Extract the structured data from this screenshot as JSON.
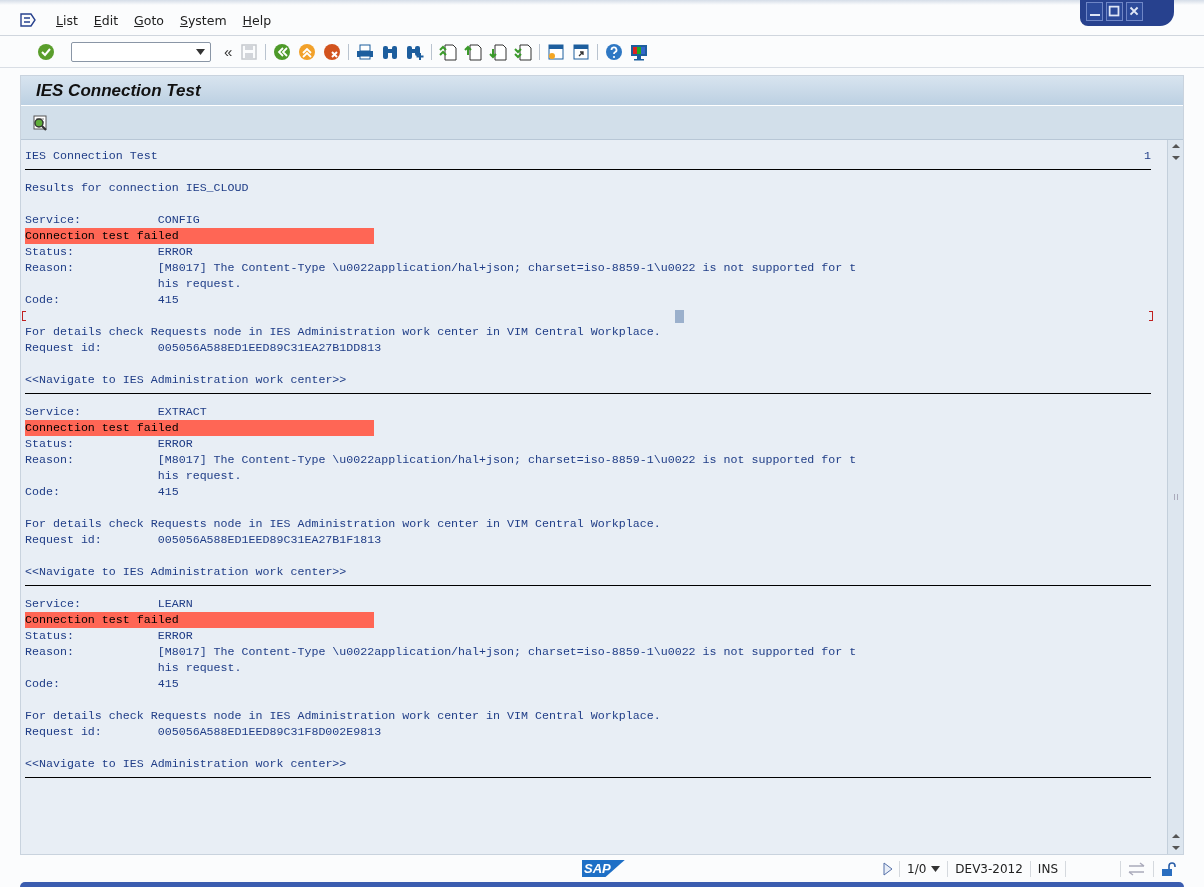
{
  "menu": [
    {
      "label": "List"
    },
    {
      "label": "Edit"
    },
    {
      "label": "Goto"
    },
    {
      "label": "System"
    },
    {
      "label": "Help"
    }
  ],
  "toolbar": [
    [
      {
        "kind": "enter",
        "disabled": false
      },
      {
        "kind": "command_field",
        "disabled": false
      },
      {
        "kind": "collapse",
        "label": "«",
        "disabled": false
      },
      {
        "kind": "save",
        "disabled": true
      }
    ],
    [
      {
        "kind": "back",
        "disabled": false
      },
      {
        "kind": "exit",
        "disabled": false
      },
      {
        "kind": "cancel",
        "disabled": false
      }
    ],
    [
      {
        "kind": "print",
        "disabled": false
      },
      {
        "kind": "find",
        "disabled": false
      },
      {
        "kind": "find_next",
        "disabled": false
      }
    ],
    [
      {
        "kind": "first_page",
        "disabled": false
      },
      {
        "kind": "previous_page",
        "disabled": false
      },
      {
        "kind": "next_page",
        "disabled": false
      },
      {
        "kind": "last_page",
        "disabled": false
      }
    ],
    [
      {
        "kind": "new_session",
        "disabled": false
      },
      {
        "kind": "shortcut",
        "disabled": false
      }
    ],
    [
      {
        "kind": "help",
        "disabled": false
      },
      {
        "kind": "layout",
        "disabled": false
      }
    ]
  ],
  "title": "IES Connection Test",
  "list": {
    "header": "IES Connection Test",
    "page": "1",
    "intro": "Results for connection IES_CLOUD",
    "results": [
      {
        "service_label": "Service:",
        "service": "CONFIG",
        "banner": "Connection test failed",
        "status_label": "Status:",
        "status": "ERROR",
        "reason_label": "Reason:",
        "reason": [
          "[M8017] The Content-Type \\u0022application/hal+json; charset=iso-8859-1\\u0022 is not supported for t",
          "his request."
        ],
        "code_label": "Code:",
        "code": "415",
        "focused": true,
        "details": "For details check Requests node in IES Administration work center in VIM Central Workplace.",
        "request_label": "Request id:",
        "request_id": "005056A588ED1EED89C31EA27B1DD813",
        "link": "<<Navigate to IES Administration work center>>"
      },
      {
        "service_label": "Service:",
        "service": "EXTRACT",
        "banner": "Connection test failed",
        "status_label": "Status:",
        "status": "ERROR",
        "reason_label": "Reason:",
        "reason": [
          "[M8017] The Content-Type \\u0022application/hal+json; charset=iso-8859-1\\u0022 is not supported for t",
          "his request."
        ],
        "code_label": "Code:",
        "code": "415",
        "focused": false,
        "details": "For details check Requests node in IES Administration work center in VIM Central Workplace.",
        "request_label": "Request id:",
        "request_id": "005056A588ED1EED89C31EA27B1F1813",
        "link": "<<Navigate to IES Administration work center>>"
      },
      {
        "service_label": "Service:",
        "service": "LEARN",
        "banner": "Connection test failed",
        "status_label": "Status:",
        "status": "ERROR",
        "reason_label": "Reason:",
        "reason": [
          "[M8017] The Content-Type \\u0022application/hal+json; charset=iso-8859-1\\u0022 is not supported for t",
          "his request."
        ],
        "code_label": "Code:",
        "code": "415",
        "focused": false,
        "details": "For details check Requests node in IES Administration work center in VIM Central Workplace.",
        "request_label": "Request id:",
        "request_id": "005056A588ED1EED89C31F8D002E9813",
        "link": "<<Navigate to IES Administration work center>>"
      }
    ]
  },
  "status_bar": {
    "logo": "SAP",
    "session": "1/0",
    "system": "DEV3-2012",
    "mode": "INS"
  }
}
